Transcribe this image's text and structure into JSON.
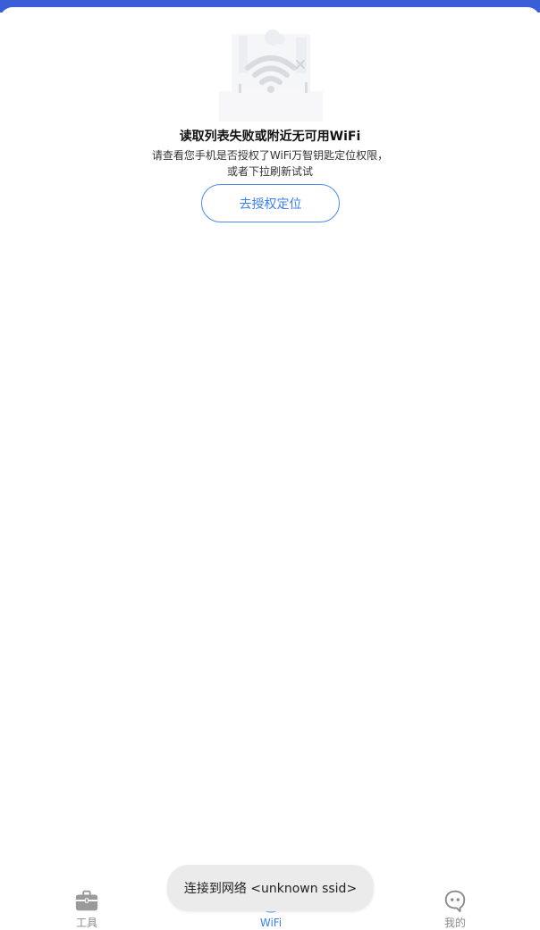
{
  "colors": {
    "brand": "#3a5ed8",
    "accent": "#3a7ef0",
    "tab_inactive": "#8a8a8a",
    "toast_bg": "#ebebeb"
  },
  "empty_state": {
    "icon": "wifi-error-illustration",
    "title": "读取列表失败或附近无可用WiFi",
    "desc_line1": "请查看您手机是否授权了WiFi万智钥匙定位权限，",
    "desc_line2": "或者下拉刷新试试",
    "button_label": "去授权定位"
  },
  "tabs": [
    {
      "label": "工具",
      "icon": "toolbox-icon",
      "active": false
    },
    {
      "label": "WiFi",
      "icon": "wifi-icon",
      "active": true
    },
    {
      "label": "我的",
      "icon": "chat-face-icon",
      "active": false
    }
  ],
  "toast": {
    "text": "连接到网络 <unknown ssid>"
  }
}
